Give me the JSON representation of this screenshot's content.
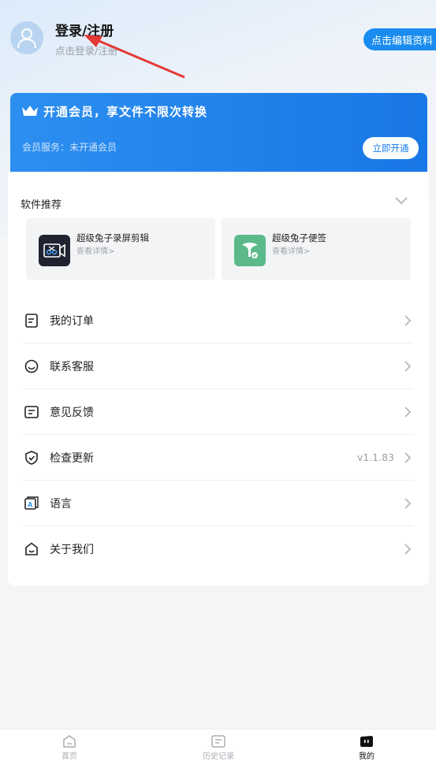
{
  "header": {
    "title": "登录/注册",
    "subtitle": "点击登录/注册",
    "edit_button": "点击编辑资料"
  },
  "vip": {
    "title": "开通会员，享文件不限次转换",
    "status": "会员服务：未开通会员",
    "button": "立即开通"
  },
  "recommend": {
    "title": "软件推荐",
    "apps": [
      {
        "name": "超级兔子录屏剪辑",
        "link": "查看详情>",
        "icon": "screen-recorder-icon"
      },
      {
        "name": "超级兔子便签",
        "link": "查看详情>",
        "icon": "notes-icon"
      }
    ]
  },
  "menu": {
    "items": [
      {
        "label": "我的订单",
        "icon": "order-icon"
      },
      {
        "label": "联系客服",
        "icon": "customer-service-icon"
      },
      {
        "label": "意见反馈",
        "icon": "feedback-icon"
      },
      {
        "label": "检查更新",
        "icon": "update-icon",
        "value": "v1.1.83"
      },
      {
        "label": "语言",
        "icon": "language-icon"
      },
      {
        "label": "关于我们",
        "icon": "about-icon"
      }
    ]
  },
  "bottom_nav": {
    "items": [
      {
        "label": "首页",
        "icon": "home-icon",
        "active": false
      },
      {
        "label": "历史记录",
        "icon": "history-icon",
        "active": false
      },
      {
        "label": "我的",
        "icon": "profile-icon",
        "active": true
      }
    ]
  },
  "colors": {
    "accent": "#1a8cf0",
    "vip_banner": "#1877e6",
    "background": "#f4f5f7"
  }
}
